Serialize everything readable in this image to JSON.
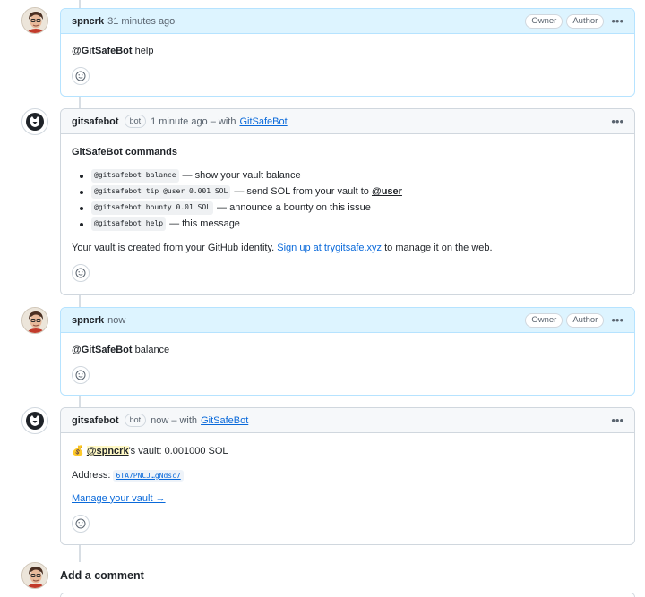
{
  "comments": [
    {
      "author": "spncrk",
      "time": "31 minutes ago",
      "badges": [
        "Owner",
        "Author"
      ],
      "mention": "@GitSafeBot",
      "text": "help"
    },
    {
      "author": "gitsafebot",
      "bot_badge": "bot",
      "time": "1 minute ago – with",
      "with_link": "GitSafeBot",
      "title": "GitSafeBot commands",
      "commands": [
        {
          "code": "@gitsafebot balance",
          "desc": "— show your vault balance"
        },
        {
          "code": "@gitsafebot tip @user 0.001 SOL",
          "desc": "— send SOL from your vault to",
          "mention": "@user"
        },
        {
          "code": "@gitsafebot bounty 0.01 SOL",
          "desc": "— announce a bounty on this issue"
        },
        {
          "code": "@gitsafebot help",
          "desc": "— this message"
        }
      ],
      "footer_pre": "Your vault is created from your GitHub identity.",
      "footer_link": "Sign up at trygitsafe.xyz",
      "footer_post": "to manage it on the web."
    },
    {
      "author": "spncrk",
      "time": "now",
      "badges": [
        "Owner",
        "Author"
      ],
      "mention": "@GitSafeBot",
      "text": "balance"
    },
    {
      "author": "gitsafebot",
      "bot_badge": "bot",
      "time": "now – with",
      "with_link": "GitSafeBot",
      "vault_emoji": "💰",
      "vault_mention": "@spncrk",
      "vault_text": "'s vault: 0.001000 SOL",
      "address_label": "Address:",
      "address_value": "6TA7PNCJ…gNdsc7",
      "manage_link": "Manage your vault →"
    }
  ],
  "add_comment_title": "Add a comment",
  "colors": {
    "accent": "#0969da",
    "own_header": "#ddf4ff",
    "own_border": "#b6e3ff"
  }
}
